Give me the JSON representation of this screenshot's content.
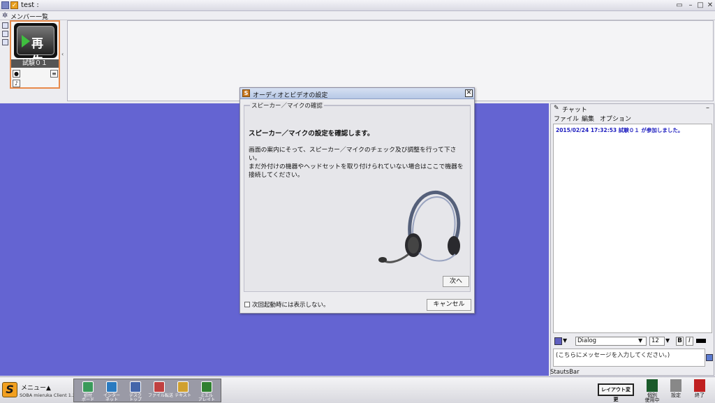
{
  "window": {
    "title": "test :",
    "buttons": [
      "▭",
      "–",
      "□",
      "✕"
    ]
  },
  "member_list": {
    "header": "メンバー一覧",
    "member_name": "試験０１",
    "play_label": "再生"
  },
  "dialog": {
    "title": "オーディオとビデオの設定",
    "group_label": "スピーカー／マイクの確認",
    "heading": "スピーカー／マイクの設定を確認します。",
    "body": "画面の案内にそって、スピーカー／マイクのチェック及び調整を行って下さい。\nまだ外付けの機器やヘッドセットを取り付けられていない場合はここで機器を接続してください。",
    "next_label": "次へ",
    "dont_show_label": "次回起動時には表示しない。",
    "cancel_label": "キャンセル"
  },
  "chat": {
    "title": "チャット",
    "menu": [
      "ファイル",
      "編集",
      "オプション"
    ],
    "messages": [
      "2015/02/24 17:32:53 試験０１ が参加しました。"
    ],
    "font_name": "Dialog",
    "font_size": "12",
    "bold_label": "B",
    "italic_label": "I",
    "input_placeholder": "(こちらにメッセージを入力してください。)",
    "status": "StautsBar"
  },
  "bottom": {
    "menu_label": "メニュー▲",
    "version": "SOBA mieruka Client 1.2.5",
    "tools": [
      {
        "label": "初付\nボード",
        "icon": "whiteboard-icon",
        "color": "#3a9a5a"
      },
      {
        "label": "インター\nネット",
        "icon": "globe-icon",
        "color": "#2a7ac0"
      },
      {
        "label": "デスク\nトップ",
        "icon": "desktop-icon",
        "color": "#4466aa"
      },
      {
        "label": "ファイル転送",
        "icon": "file-transfer-icon",
        "color": "#c04040"
      },
      {
        "label": "テキスト",
        "icon": "text-icon",
        "color": "#d0a030"
      },
      {
        "label": "ミエル\nアレイト",
        "icon": "movie-icon",
        "color": "#308030"
      }
    ],
    "layout_label": "レイアウト変更",
    "right_buttons": [
      {
        "label": "個別\n使用中",
        "icon": "person-icon",
        "color": "#1a5a2a"
      },
      {
        "label": "設定",
        "icon": "gear-icon",
        "color": "#888888"
      },
      {
        "label": "終了",
        "icon": "exit-icon",
        "color": "#c02020"
      }
    ]
  }
}
